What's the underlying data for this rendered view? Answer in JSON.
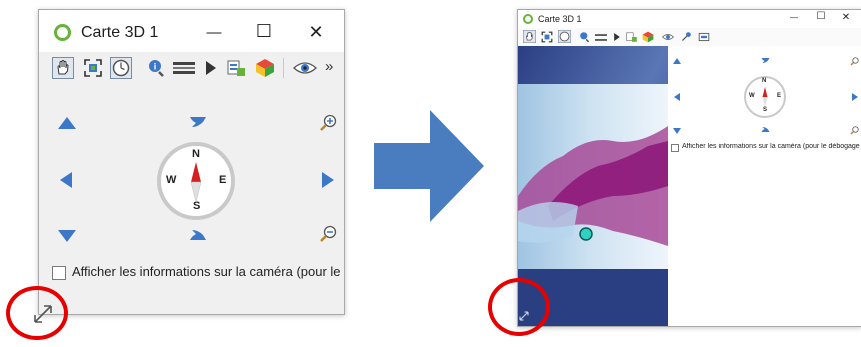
{
  "left_window": {
    "title": "Carte 3D 1",
    "minimize_glyph": "—",
    "maximize_glyph": "☐",
    "close_glyph": "✕",
    "overflow_glyph": "»",
    "compass": {
      "north": "N",
      "south": "S",
      "east": "E",
      "west": "W"
    },
    "checkbox_label": "Afficher les informations sur la caméra (pour le dé",
    "checkbox_checked": false
  },
  "right_window": {
    "title": "Carte 3D 1",
    "minimize_glyph": "—",
    "maximize_glyph": "☐",
    "close_glyph": "✕",
    "compass": {
      "north": "N",
      "south": "S",
      "east": "E",
      "west": "W"
    },
    "checkbox_label": "Afficher les informations sur la caméra (pour le débogage)",
    "checkbox_checked": false
  },
  "icons": {
    "pan": "hand-icon",
    "zoom_full": "zoom-full-icon",
    "camera_control": "camera-control-icon",
    "identify": "identify-icon",
    "measure": "measure-line-icon",
    "animation": "play-icon",
    "export": "export-icon",
    "layers": "layers-icon",
    "view": "eye-icon",
    "zoom_in": "zoom-in-icon",
    "zoom_out": "zoom-out-icon",
    "resize": "resize-grip-icon"
  },
  "colors": {
    "qgis_green": "#66b23a",
    "nav_blue": "#3d78c8",
    "compass_red": "#d42020",
    "highlight_red": "#e60000",
    "transition_arrow": "#4a7dbf",
    "terrain_purple": "#8e1a7a",
    "marker_cyan": "#2fd1c0"
  }
}
